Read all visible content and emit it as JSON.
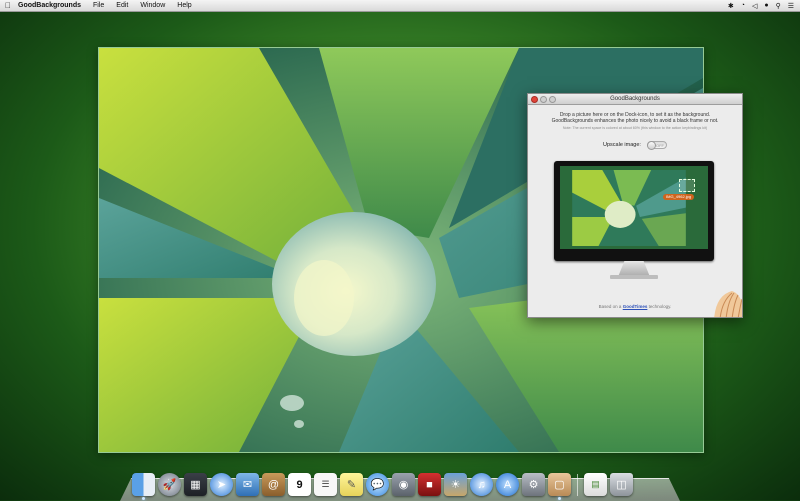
{
  "menubar": {
    "app_name": "GoodBackgrounds",
    "items": [
      "File",
      "Edit",
      "Window",
      "Help"
    ]
  },
  "window": {
    "title": "GoodBackgrounds",
    "description_line1": "Drop a picture here or on the Dock-icon, to set it as the background.",
    "description_line2": "GoodBackgrounds enhances the photo nicely to avoid a black frame or not.",
    "note": "Note: The current space is colored at about 60% (this window to the action keybindings kit)",
    "upscale_label": "Upscale image:",
    "toggle_state": "OFF",
    "toggle_on": false,
    "file_label": "IMG_4962.jpg",
    "footer_prefix": "Based on a",
    "footer_link": "GoodTimes",
    "footer_suffix": "technology."
  },
  "dock": {
    "icons": [
      "finder-icon",
      "launchpad-icon",
      "mission-control-icon",
      "safari-icon",
      "mail-icon",
      "contacts-icon",
      "calendar-icon",
      "reminders-icon",
      "notes-icon",
      "messages-icon",
      "facetime-icon",
      "photo-booth-icon",
      "iphoto-icon",
      "itunes-icon",
      "app-store-icon",
      "system-preferences-icon",
      "goodbackgrounds-icon",
      "document-icon",
      "trash-icon"
    ],
    "calendar_day": "9"
  },
  "colors": {
    "accent_orange": "#d0641c",
    "link_blue": "#2a4fb8"
  }
}
